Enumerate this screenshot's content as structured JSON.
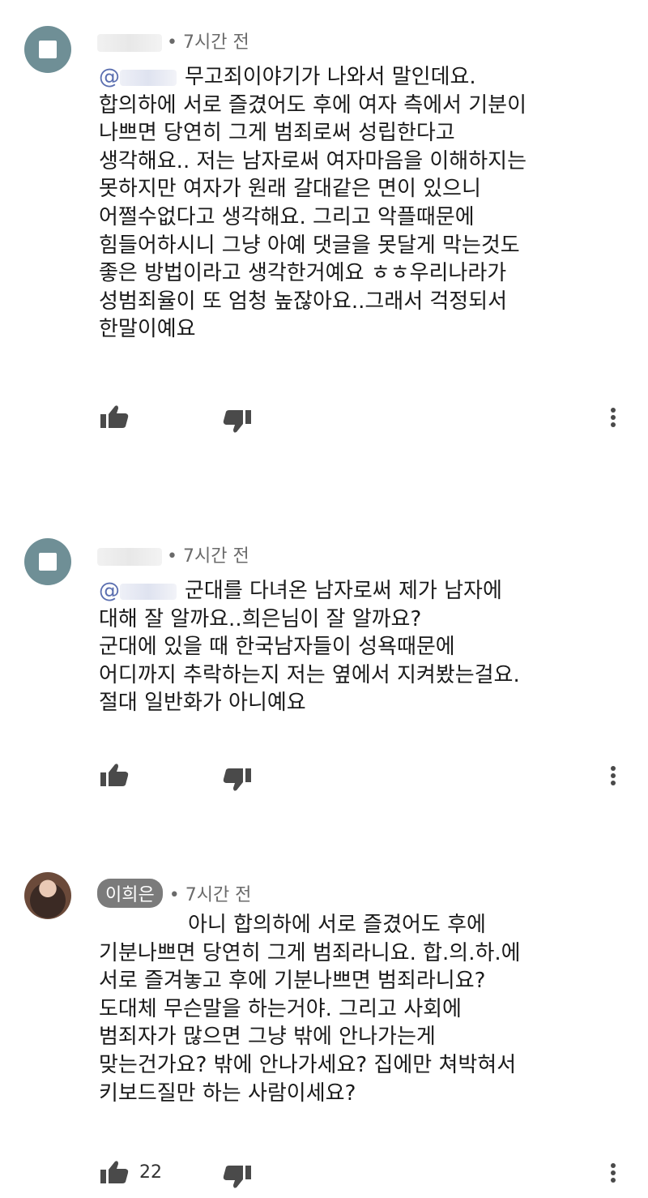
{
  "comments": [
    {
      "time": "• 7시간 전",
      "mention": "@",
      "lines": [
        "무고죄이야기가 나와서 말인데요.",
        "합의하에 서로 즐겼어도 후에 여자 측에서 기분이",
        "나쁘면 당연히 그게 범죄로써 성립한다고",
        "생각해요.. 저는 남자로써 여자마음을 이해하지는",
        "못하지만 여자가 원래 갈대같은 면이 있으니",
        "어쩔수없다고 생각해요. 그리고 악플때문에",
        "힘들어하시니 그냥 아예 댓글을 못달게 막는것도",
        "좋은 방법이라고 생각한거예요 ㅎㅎ우리나라가",
        "성범죄율이 또 엄청 높잖아요..그래서 걱정되서",
        "한말이예요"
      ],
      "like_count": ""
    },
    {
      "time": "• 7시간 전",
      "mention": "@",
      "lines": [
        "군대를 다녀온 남자로써 제가 남자에",
        "대해 잘 알까요..희은님이 잘 알까요?",
        "군대에 있을 때  한국남자들이 성욕때문에",
        "어디까지 추락하는지 저는 옆에서 지켜봤는걸요.",
        "절대 일반화가 아니예요"
      ],
      "like_count": ""
    },
    {
      "author": "이희은",
      "time": "• 7시간 전",
      "lines": [
        "아니 합의하에 서로 즐겼어도 후에",
        "기분나쁘면 당연히 그게 범죄라니요. 합.의.하.에",
        "서로 즐겨놓고 후에 기분나쁘면 범죄라니요?",
        "도대체 무슨말을 하는거야. 그리고 사회에",
        "범죄자가 많으면 그냥 밖에 안나가는게",
        "맞는건가요? 밖에 안나가세요? 집에만 쳐박혀서",
        "키보드질만 하는 사람이세요?"
      ],
      "like_count": "22"
    }
  ],
  "icons": {
    "like": "thumbs-up-icon",
    "dislike": "thumbs-down-icon",
    "more": "more-vertical-icon"
  }
}
